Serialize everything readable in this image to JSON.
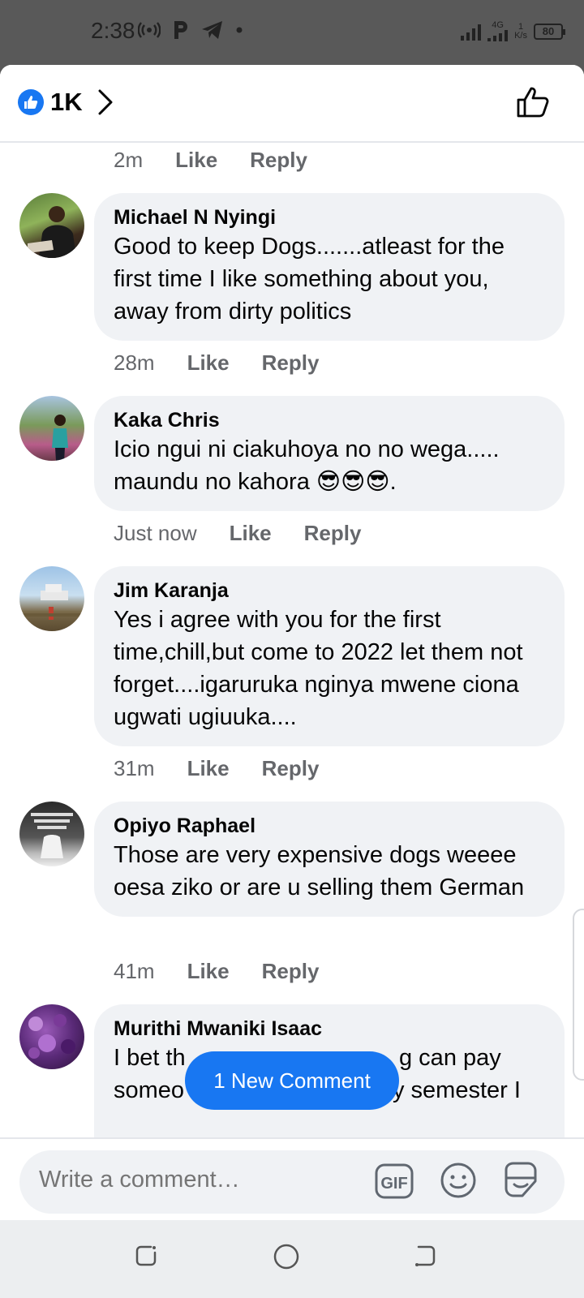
{
  "status_bar": {
    "time": "2:38",
    "network_type": "4G",
    "data_rate_value": "1",
    "data_rate_unit": "K/s",
    "battery": "80"
  },
  "header": {
    "reaction_count": "1K"
  },
  "prev_comment_meta": {
    "time": "2m",
    "like_label": "Like",
    "reply_label": "Reply"
  },
  "comments": [
    {
      "author": "Michael N Nyingi",
      "text": "Good to keep Dogs.......atleast for the first time I like something about you, away from dirty politics",
      "time": "28m",
      "like_label": "Like",
      "reply_label": "Reply"
    },
    {
      "author": "Kaka Chris",
      "text": "Icio ngui ni ciakuhoya no no wega..... maundu no kahora 😎😎😎.",
      "time": "Just now",
      "like_label": "Like",
      "reply_label": "Reply"
    },
    {
      "author": "Jim Karanja",
      "text": "Yes i agree with you for the first time,chill,but come to 2022 let them not forget....igaruruka nginya mwene ciona ugwati ugiuuka....",
      "time": "31m",
      "like_label": "Like",
      "reply_label": "Reply"
    },
    {
      "author": "Opiyo Raphael",
      "text": "Those are very expensive dogs weeee oesa ziko or are u selling them German",
      "time": "41m",
      "like_label": "Like",
      "reply_label": "Reply"
    },
    {
      "author": "Murithi Mwaniki Isaac",
      "text_visible_line1_left": "I bet th",
      "text_visible_line1_right": "g can pay",
      "text_visible_line2_left": "someo",
      "text_visible_line2_right": "y semester I"
    }
  ],
  "new_comment_pill": "1 New Comment",
  "composer": {
    "placeholder": "Write a comment…",
    "gif_label": "GIF"
  },
  "colors": {
    "accent": "#1877f2",
    "bubble": "#f0f2f5",
    "meta_text": "#65676b"
  }
}
